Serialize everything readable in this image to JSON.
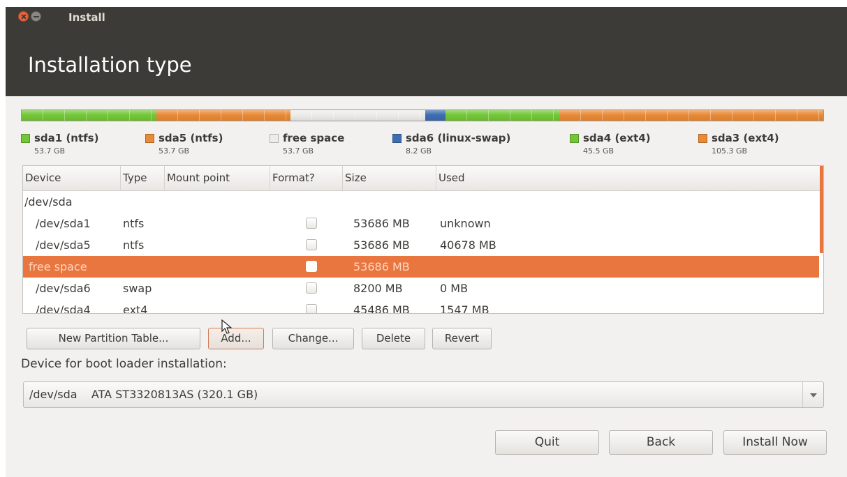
{
  "window": {
    "title": "Install"
  },
  "page": {
    "title": "Installation type"
  },
  "partitions": [
    {
      "name": "sda1 (ntfs)",
      "size": "53.7 GB",
      "color": "#73c737",
      "gb": 53.7
    },
    {
      "name": "sda5 (ntfs)",
      "size": "53.7 GB",
      "color": "#e98a36",
      "gb": 53.7
    },
    {
      "name": "free space",
      "size": "53.7 GB",
      "color": "#ececea",
      "gb": 53.7
    },
    {
      "name": "sda6 (linux-swap)",
      "size": "8.2 GB",
      "color": "#3e6db0",
      "gb": 8.2
    },
    {
      "name": "sda4 (ext4)",
      "size": "45.5 GB",
      "color": "#73c737",
      "gb": 45.5
    },
    {
      "name": "sda3 (ext4)",
      "size": "105.3 GB",
      "color": "#e98a36",
      "gb": 105.3
    }
  ],
  "table": {
    "headers": {
      "device": "Device",
      "type": "Type",
      "mount": "Mount point",
      "format": "Format?",
      "size": "Size",
      "used": "Used"
    },
    "rows": [
      {
        "device": "/dev/sda",
        "type": "",
        "format": false,
        "size": "",
        "used": ""
      },
      {
        "device": "/dev/sda1",
        "type": "ntfs",
        "format": true,
        "size": "53686 MB",
        "used": "unknown"
      },
      {
        "device": "/dev/sda5",
        "type": "ntfs",
        "format": true,
        "size": "53686 MB",
        "used": "40678 MB"
      },
      {
        "device": "free space",
        "type": "",
        "format": true,
        "size": "53686 MB",
        "used": "",
        "selected": true
      },
      {
        "device": "/dev/sda6",
        "type": "swap",
        "format": true,
        "size": "8200 MB",
        "used": "0 MB"
      },
      {
        "device": "/dev/sda4",
        "type": "ext4",
        "format": true,
        "size": "45486 MB",
        "used": "1547 MB"
      }
    ]
  },
  "buttons": {
    "new_partition_table": "New Partition Table...",
    "add": "Add...",
    "change": "Change...",
    "delete": "Delete",
    "revert": "Revert"
  },
  "boot_loader": {
    "label": "Device for boot loader installation:",
    "device": "/dev/sda",
    "description": "ATA ST3320813AS (320.1 GB)"
  },
  "footer": {
    "quit": "Quit",
    "back": "Back",
    "install_now": "Install Now"
  },
  "colors": {
    "header_bg": "#3c3b37",
    "accent": "#e9753f",
    "window_bg": "#f2f1f0"
  }
}
